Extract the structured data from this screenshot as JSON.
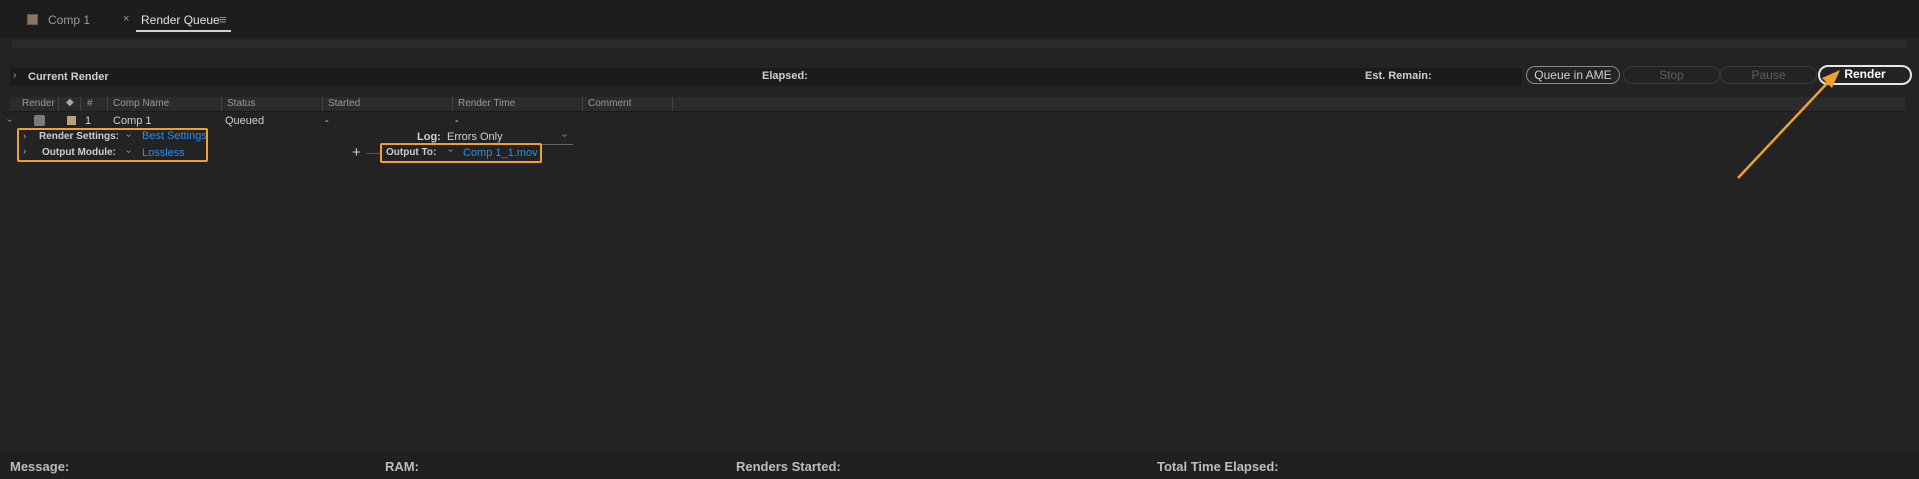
{
  "tabs": [
    {
      "label": "Comp 1"
    },
    {
      "label": "Render Queue",
      "close": "×",
      "menu": "≡"
    }
  ],
  "current_render": {
    "label": "Current Render",
    "elapsed_label": "Elapsed:",
    "est_remain_label": "Est. Remain:"
  },
  "buttons": {
    "queue_in_ame": "Queue in AME",
    "stop": "Stop",
    "pause": "Pause",
    "render": "Render"
  },
  "columns": [
    "Render",
    "#",
    "Comp Name",
    "Status",
    "Started",
    "Render Time",
    "Comment"
  ],
  "item": {
    "number": "1",
    "comp_name": "Comp 1",
    "status": "Queued",
    "started": "-",
    "render_time": "-"
  },
  "render_settings": {
    "label": "Render Settings:",
    "value": "Best Settings"
  },
  "output_module": {
    "label": "Output Module:",
    "value": "Lossless"
  },
  "log": {
    "label": "Log:",
    "value": "Errors Only"
  },
  "output_to": {
    "label": "Output To:",
    "value": "Comp 1_1.mov"
  },
  "add_output": "+",
  "status_bar": {
    "message": "Message:",
    "ram": "RAM:",
    "renders_started": "Renders Started:",
    "total_time_elapsed": "Total Time Elapsed:"
  },
  "colors": {
    "highlight": "#f0a030",
    "link": "#2d8ceb",
    "background": "#232323"
  }
}
